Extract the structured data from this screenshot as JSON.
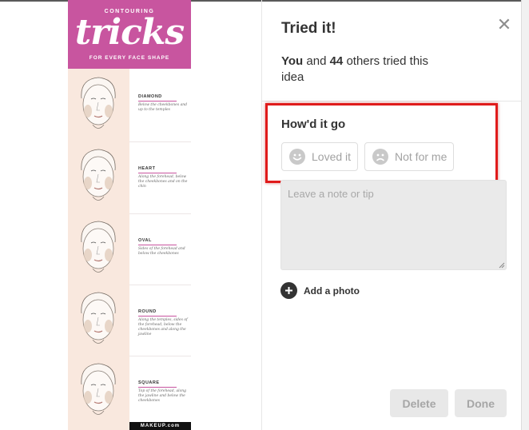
{
  "pin": {
    "header_small": "CONTOURING",
    "header_title": "tricks",
    "header_sub": "FOR EVERY FACE SHAPE",
    "shapes": [
      {
        "name": "DIAMOND",
        "desc": "Below the cheekbones and up to the temples"
      },
      {
        "name": "HEART",
        "desc": "Along the forehead, below the cheekbones and on the chin"
      },
      {
        "name": "OVAL",
        "desc": "Sides of the forehead and below the cheekbones"
      },
      {
        "name": "ROUND",
        "desc": "Along the temples, sides of the forehead, below the cheekbones and along the jawline"
      },
      {
        "name": "SQUARE",
        "desc": "Top of the forehead, along the jawline and below the cheekbones"
      }
    ],
    "brand": "MAKEUP.com"
  },
  "panel": {
    "title": "Tried it!",
    "close_glyph": "✕",
    "tried_you": "You",
    "tried_and": "and",
    "tried_count": "44",
    "tried_rest": "others tried this idea",
    "question": "How'd it go",
    "loved_label": "Loved it",
    "notfor_label": "Not for me",
    "note_placeholder": "Leave a note or tip",
    "note_value": "",
    "add_photo_label": "Add a photo",
    "delete_label": "Delete",
    "done_label": "Done"
  },
  "colors": {
    "highlight": "#e01b1b",
    "pin_pink": "#c8559f",
    "disabled_bg": "#e8e8e8"
  }
}
